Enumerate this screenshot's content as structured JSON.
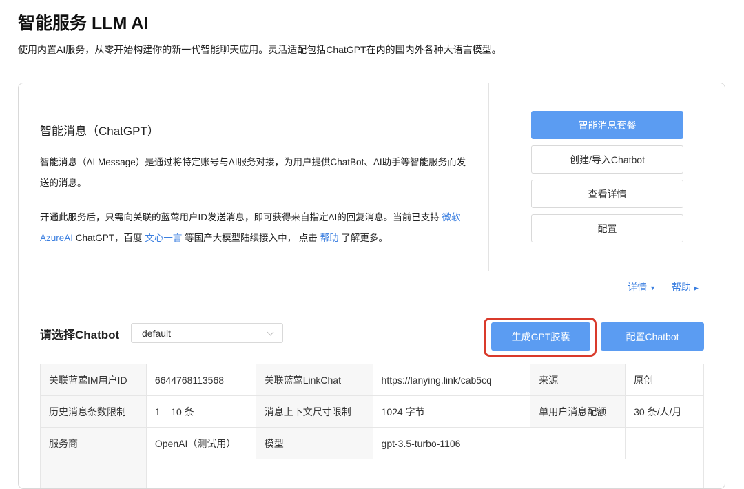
{
  "header": {
    "title": "智能服务 LLM AI",
    "subtitle": "使用内置AI服务，从零开始构建你的新一代智能聊天应用。灵活适配包括ChatGPT在内的国内外各种大语言模型。"
  },
  "service": {
    "title": "智能消息（ChatGPT）",
    "desc1": "智能消息（AI Message）是通过将特定账号与AI服务对接，为用户提供ChatBot、AI助手等智能服务而发送的消息。",
    "desc2_part1": "开通此服务后，只需向关联的蓝莺用户ID发送消息，即可获得来自指定AI的回复消息。当前已支持",
    "desc2_link1": "微软AzureAI",
    "desc2_part2": " ChatGPT，百度",
    "desc2_link2": "文心一言",
    "desc2_part3": "等国产大模型陆续接入中， 点击",
    "desc2_link3": "帮助",
    "desc2_part4": "了解更多。"
  },
  "side_buttons": {
    "package": "智能消息套餐",
    "create": "创建/导入Chatbot",
    "details": "查看详情",
    "config": "配置"
  },
  "detail_bar": {
    "details": "详情",
    "help": "帮助"
  },
  "chatbot": {
    "label": "请选择Chatbot",
    "selected": "default",
    "generate_btn": "生成GPT胶囊",
    "config_btn": "配置Chatbot"
  },
  "table": {
    "rows": [
      [
        "关联蓝莺IM用户ID",
        "6644768113568",
        "关联蓝莺LinkChat",
        "https://lanying.link/cab5cq",
        "来源",
        "原创"
      ],
      [
        "历史消息条数限制",
        "1 – 10 条",
        "消息上下文尺寸限制",
        "1024 字节",
        "单用户消息配额",
        "30 条/人/月"
      ],
      [
        "服务商",
        "OpenAI（测试用）",
        "模型",
        "gpt-3.5-turbo-1106",
        "",
        ""
      ]
    ]
  },
  "colors": {
    "primary": "#5b9cf2",
    "link": "#3b7fe0",
    "highlight": "#d93a2b"
  }
}
